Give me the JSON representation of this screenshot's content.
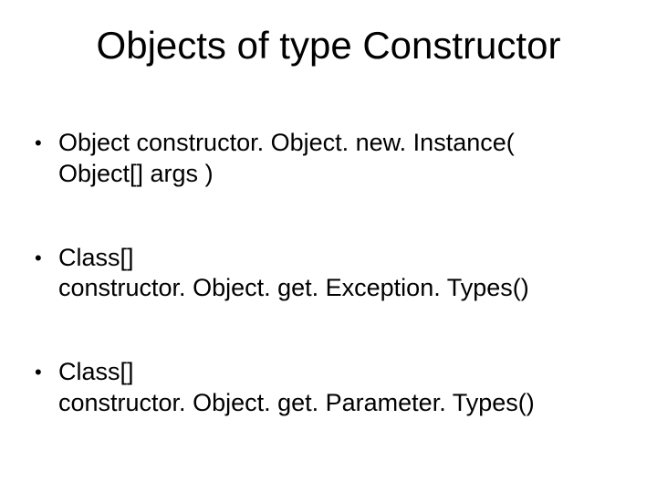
{
  "title": "Objects of type Constructor",
  "bullets": [
    {
      "line1": "Object constructor. Object. new. Instance(",
      "line2": "Object[] args )"
    },
    {
      "line1": "Class[]",
      "line2": "constructor. Object. get. Exception. Types()"
    },
    {
      "line1": "Class[]",
      "line2": "constructor. Object. get. Parameter. Types()"
    }
  ]
}
